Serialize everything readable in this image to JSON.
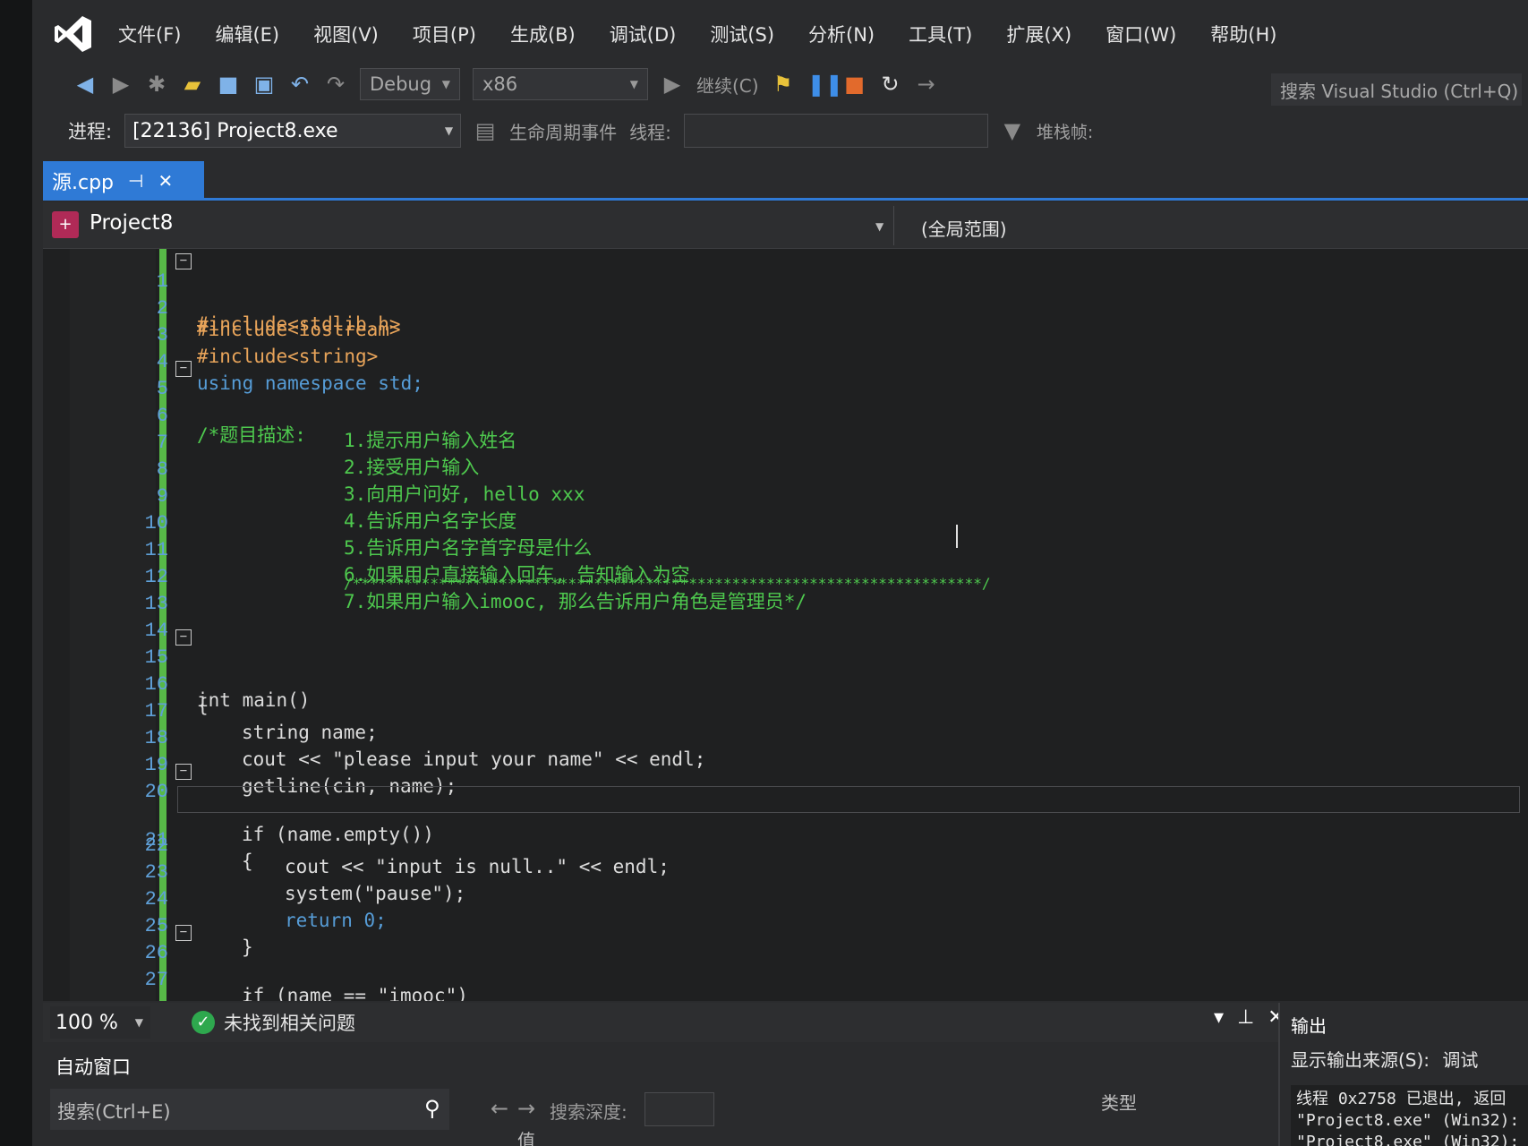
{
  "menu": {
    "items": [
      "文件(F)",
      "编辑(E)",
      "视图(V)",
      "项目(P)",
      "生成(B)",
      "调试(D)",
      "测试(S)",
      "分析(N)",
      "工具(T)",
      "扩展(X)",
      "窗口(W)",
      "帮助(H)"
    ]
  },
  "toolbar": {
    "config": "Debug",
    "platform": "x86",
    "continue_label": "继续(C)",
    "search_placeholder": "搜索 Visual Studio (Ctrl+Q)"
  },
  "process_bar": {
    "label": "进程:",
    "process": "[22136] Project8.exe",
    "lifecycle_label": "生命周期事件",
    "thread_label": "线程:",
    "stack_label": "堆栈帧:"
  },
  "tab": {
    "title": "源.cpp",
    "pin": "⊣",
    "close": "✕"
  },
  "navbar": {
    "project": "Project8",
    "scope": "(全局范围)"
  },
  "code_lines": [
    {
      "n": "1",
      "text": "#include<stdlib.h>"
    },
    {
      "n": "2",
      "text": "#include<iostream>"
    },
    {
      "n": "3",
      "text": "#include<string>"
    },
    {
      "n": "4",
      "text": "using namespace std;"
    },
    {
      "n": "5",
      "text": "/*题目描述:"
    },
    {
      "n": "6",
      "text": "1.提示用户输入姓名"
    },
    {
      "n": "7",
      "text": "2.接受用户输入"
    },
    {
      "n": "8",
      "text": "3.向用户问好, hello xxx"
    },
    {
      "n": "9",
      "text": "4.告诉用户名字长度"
    },
    {
      "n": "10",
      "text": "5.告诉用户名字首字母是什么"
    },
    {
      "n": "11",
      "text": "6.如果用户直接输入回车, 告知输入为空"
    },
    {
      "n": "12",
      "text": "7.如果用户输入imooc, 那么告诉用户角色是管理员*/"
    },
    {
      "n": "13",
      "text": "/*************************************************************************/"
    },
    {
      "n": "14",
      "text": ""
    },
    {
      "n": "15",
      "text": "int main()"
    },
    {
      "n": "16",
      "text": "{"
    },
    {
      "n": "17",
      "text": "string name;"
    },
    {
      "n": "18",
      "text": "cout << \"please input your name\" << endl;"
    },
    {
      "n": "19",
      "text": "getline(cin, name);"
    },
    {
      "n": "20",
      "text": "if (name.empty())"
    },
    {
      "n": "21",
      "text": "{"
    },
    {
      "n": "22",
      "text": "cout << \"input is null..\" << endl;"
    },
    {
      "n": "23",
      "text": "system(\"pause\");"
    },
    {
      "n": "24",
      "text": "return 0;"
    },
    {
      "n": "25",
      "text": "}"
    },
    {
      "n": "26",
      "text": "if (name == \"imooc\")"
    },
    {
      "n": "27",
      "text": "{"
    }
  ],
  "status": {
    "zoom": "100 %",
    "issues": "未找到相关问题"
  },
  "autos": {
    "title": "自动窗口",
    "search_placeholder": "搜索(Ctrl+E)",
    "depth_label": "搜索深度:",
    "col_value": "值",
    "col_type": "类型"
  },
  "output": {
    "title": "输出",
    "source_label": "显示输出来源(S):",
    "source_value": "调试",
    "lines": [
      "线程 0x2758 已退出, 返回",
      "\"Project8.exe\" (Win32):",
      "\"Project8.exe\" (Win32):"
    ]
  },
  "colors": {
    "accent": "#2f7ad6",
    "keyword": "#569cd6",
    "comment": "#4ec94e",
    "string": "#d69d85",
    "change_bar": "#57b947"
  }
}
